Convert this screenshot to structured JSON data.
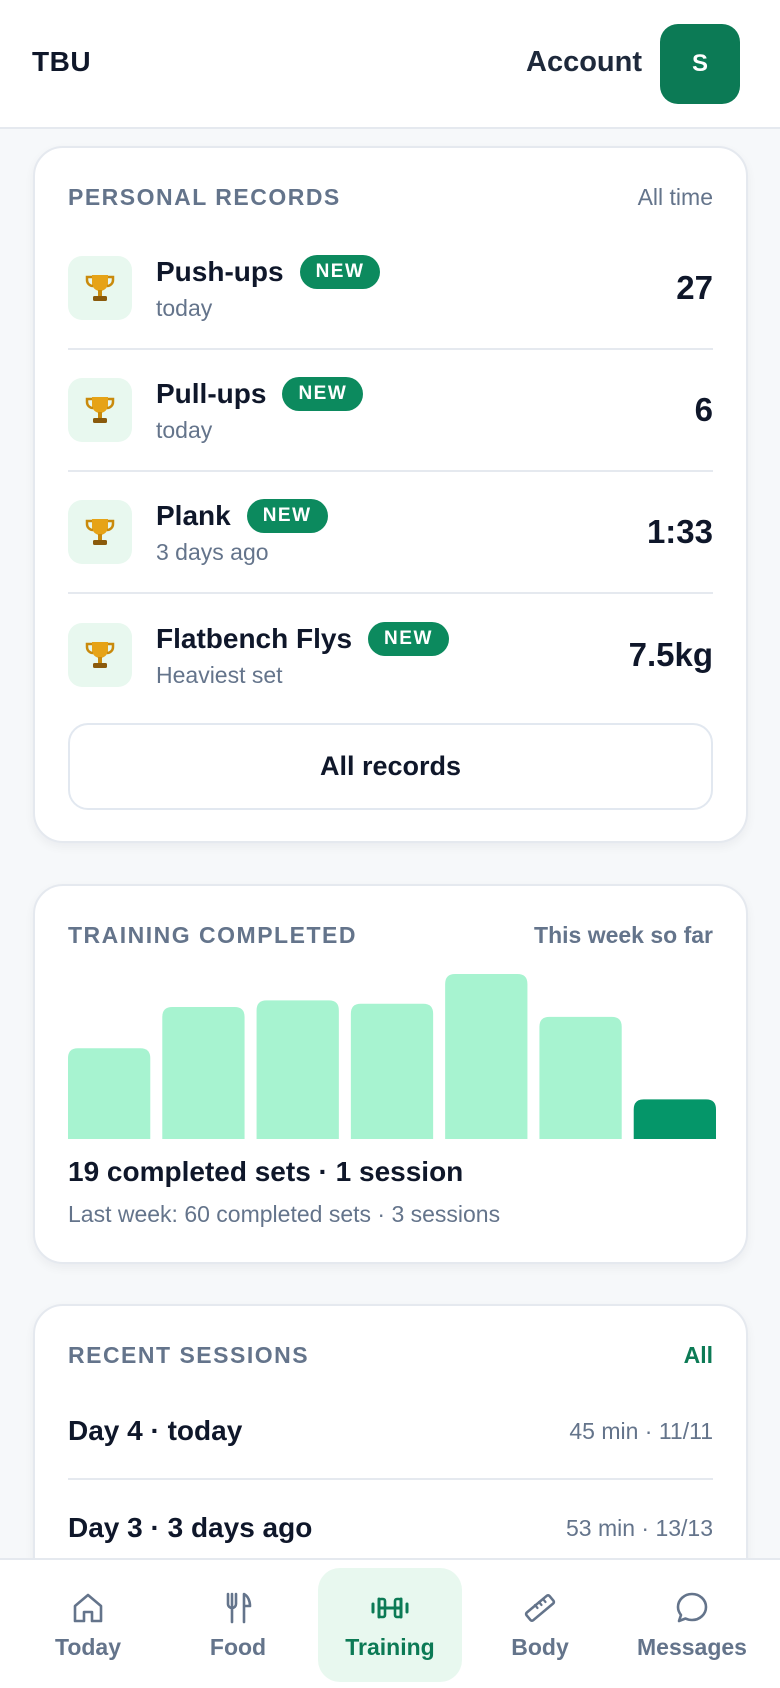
{
  "header": {
    "brand": "TBU",
    "account_label": "Account",
    "avatar_initial": "S"
  },
  "records": {
    "title": "PERSONAL RECORDS",
    "period": "All time",
    "items": [
      {
        "name": "Push-ups",
        "badge": "NEW",
        "sub": "today",
        "value": "27",
        "icon": "trophy-icon"
      },
      {
        "name": "Pull-ups",
        "badge": "NEW",
        "sub": "today",
        "value": "6",
        "icon": "trophy-icon"
      },
      {
        "name": "Plank",
        "badge": "NEW",
        "sub": "3 days ago",
        "value": "1:33",
        "icon": "trophy-icon"
      },
      {
        "name": "Flatbench Flys",
        "badge": "NEW",
        "sub": "Heaviest set",
        "value": "7.5kg",
        "icon": "trophy-icon"
      }
    ],
    "button_label": "All records"
  },
  "training": {
    "title": "TRAINING COMPLETED",
    "period": "This week so far",
    "summary": "19 completed sets · 1 session",
    "last_week": "Last week: 60 completed sets · 3 sessions"
  },
  "chart_data": {
    "type": "bar",
    "categories": [],
    "values": [
      0.55,
      0.8,
      0.84,
      0.82,
      1.0,
      0.74,
      0.24
    ],
    "highlight_index": 6,
    "colors": {
      "normal": "#a7f3d0",
      "highlight": "#059669"
    }
  },
  "sessions": {
    "title": "RECENT SESSIONS",
    "link_label": "All",
    "items": [
      {
        "title": "Day 4 · today",
        "meta": "45 min · 11/11"
      },
      {
        "title": "Day 3 · 3 days ago",
        "meta": "53 min · 13/13"
      }
    ]
  },
  "nav": {
    "items": [
      {
        "label": "Today",
        "icon": "home-icon",
        "active": false
      },
      {
        "label": "Food",
        "icon": "fork-knife-icon",
        "active": false
      },
      {
        "label": "Training",
        "icon": "dumbbell-icon",
        "active": true
      },
      {
        "label": "Body",
        "icon": "ruler-icon",
        "active": false
      },
      {
        "label": "Messages",
        "icon": "message-icon",
        "active": false
      }
    ]
  },
  "colors": {
    "brand": "#0c7a55",
    "badge": "#0c8a5e",
    "muted": "#64748b"
  }
}
